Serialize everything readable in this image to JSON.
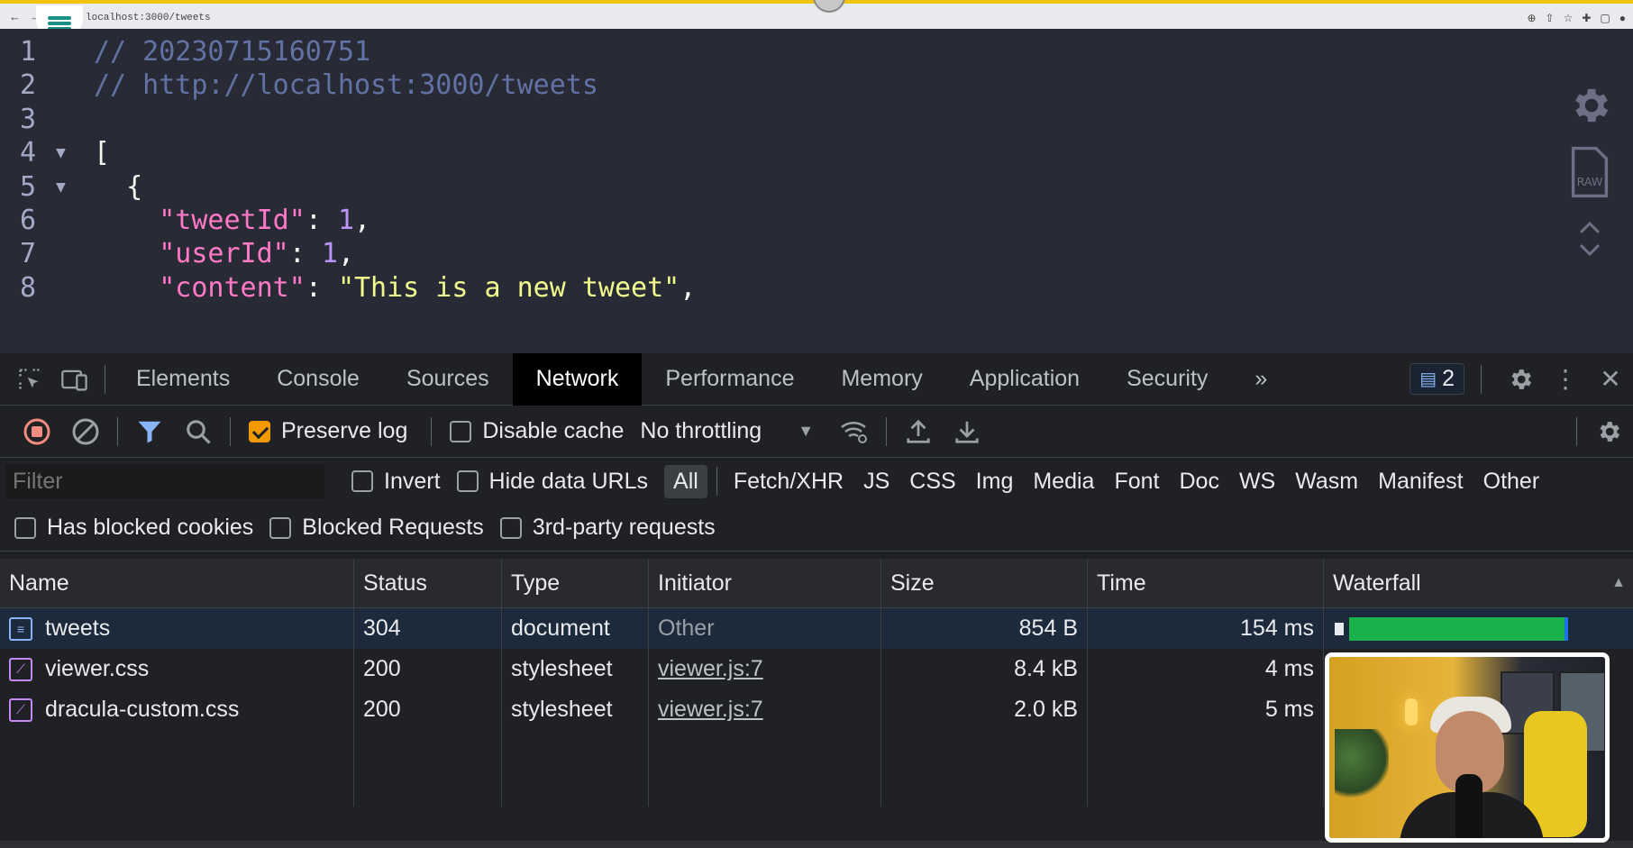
{
  "browser": {
    "url": "localhost:3000/tweets"
  },
  "viewer": {
    "lines": [
      {
        "n": "1",
        "parts": [
          {
            "t": "// 20230715160751",
            "c": "cmt"
          }
        ]
      },
      {
        "n": "2",
        "parts": [
          {
            "t": "// http://localhost:3000/tweets",
            "c": "cmt"
          }
        ]
      },
      {
        "n": "3",
        "parts": []
      },
      {
        "n": "4",
        "fold": true,
        "parts": [
          {
            "t": "[",
            "c": "pun"
          }
        ]
      },
      {
        "n": "5",
        "fold": true,
        "parts": [
          {
            "t": "  {",
            "c": "pun"
          }
        ]
      },
      {
        "n": "6",
        "parts": [
          {
            "t": "    ",
            "c": "pun"
          },
          {
            "t": "\"tweetId\"",
            "c": "key"
          },
          {
            "t": ": ",
            "c": "pun"
          },
          {
            "t": "1",
            "c": "num"
          },
          {
            "t": ",",
            "c": "pun"
          }
        ]
      },
      {
        "n": "7",
        "parts": [
          {
            "t": "    ",
            "c": "pun"
          },
          {
            "t": "\"userId\"",
            "c": "key"
          },
          {
            "t": ": ",
            "c": "pun"
          },
          {
            "t": "1",
            "c": "num"
          },
          {
            "t": ",",
            "c": "pun"
          }
        ]
      },
      {
        "n": "8",
        "parts": [
          {
            "t": "    ",
            "c": "pun"
          },
          {
            "t": "\"content\"",
            "c": "key"
          },
          {
            "t": ": ",
            "c": "pun"
          },
          {
            "t": "\"This is a new tweet\"",
            "c": "str"
          },
          {
            "t": ",",
            "c": "pun"
          }
        ]
      }
    ]
  },
  "devtools": {
    "tabs": [
      "Elements",
      "Console",
      "Sources",
      "Network",
      "Performance",
      "Memory",
      "Application",
      "Security"
    ],
    "active_tab": "Network",
    "more_tabs": "»",
    "issues_count": "2",
    "toolbar": {
      "preserve_log": "Preserve log",
      "disable_cache": "Disable cache",
      "throttling": "No throttling"
    },
    "filter": {
      "placeholder": "Filter",
      "invert": "Invert",
      "hide_data_urls": "Hide data URLs",
      "types": [
        "All",
        "Fetch/XHR",
        "JS",
        "CSS",
        "Img",
        "Media",
        "Font",
        "Doc",
        "WS",
        "Wasm",
        "Manifest",
        "Other"
      ],
      "active_type": "All",
      "has_blocked_cookies": "Has blocked cookies",
      "blocked_requests": "Blocked Requests",
      "third_party": "3rd-party requests"
    },
    "columns": {
      "name": "Name",
      "status": "Status",
      "type": "Type",
      "initiator": "Initiator",
      "size": "Size",
      "time": "Time",
      "waterfall": "Waterfall"
    },
    "rows": [
      {
        "name": "tweets",
        "status": "304",
        "type": "document",
        "initiator": "Other",
        "size": "854 B",
        "time": "154 ms"
      },
      {
        "name": "viewer.css",
        "status": "200",
        "type": "stylesheet",
        "initiator": "viewer.js:7",
        "size": "8.4 kB",
        "time": "4 ms"
      },
      {
        "name": "dracula-custom.css",
        "status": "200",
        "type": "stylesheet",
        "initiator": "viewer.js:7",
        "size": "2.0 kB",
        "time": "5 ms"
      }
    ]
  },
  "colors": {
    "viewer_bg": "#282a36",
    "comment": "#6272a4",
    "key": "#ff79c6",
    "number": "#bd93f9",
    "string": "#f1fa8c",
    "devtools_bg": "#202124",
    "record": "#f28b82",
    "checkbox_on": "#f29900",
    "waterfall_bar": "#1ab34b"
  }
}
